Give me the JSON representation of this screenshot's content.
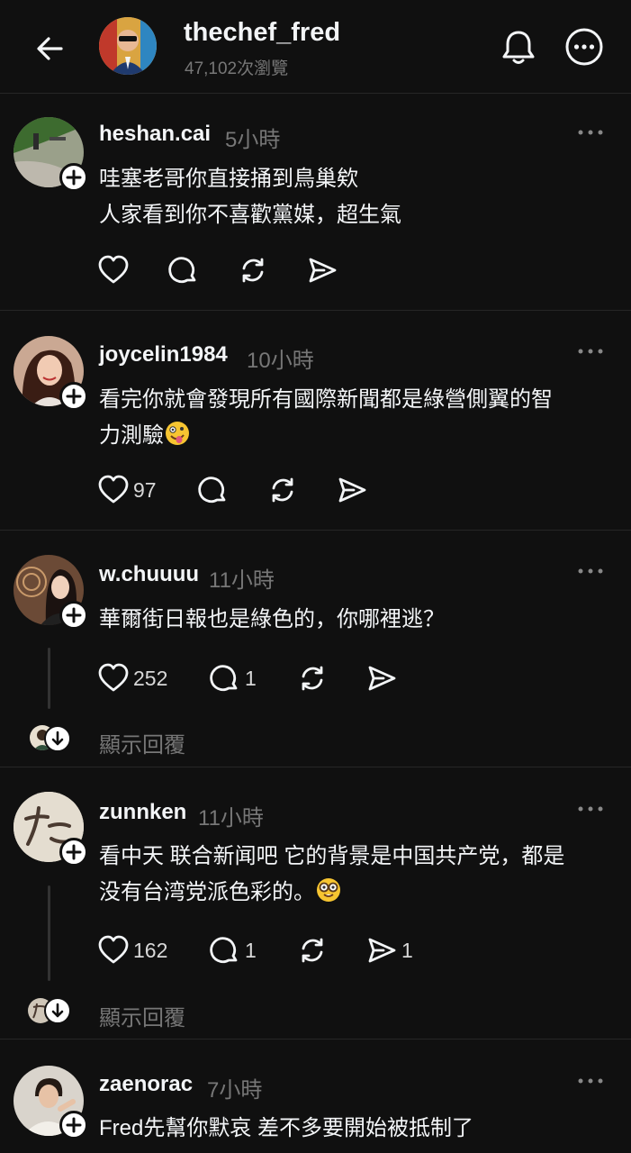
{
  "header": {
    "username": "thechef_fred",
    "views": "47,102次瀏覽"
  },
  "posts": [
    {
      "username": "heshan.cai",
      "time": "5小時",
      "lines": [
        "哇塞老哥你直接捅到鳥巢欸",
        "人家看到你不喜歡黨媒，超生氣"
      ],
      "likes": "",
      "replies": "",
      "shares": ""
    },
    {
      "username": "joycelin1984",
      "time": "10小時",
      "lines": [
        "看完你就會發現所有國際新聞都是綠營側翼的智",
        "力測驗"
      ],
      "likes": "97",
      "replies": "",
      "shares": ""
    },
    {
      "username": "w.chuuuu",
      "time": "11小時",
      "lines": [
        "華爾街日報也是綠色的，你哪裡逃？"
      ],
      "likes": "252",
      "replies": "1",
      "shares": "",
      "show_replies": "顯示回覆"
    },
    {
      "username": "zunnken",
      "time": "11小時",
      "lines": [
        "看中天 联合新闻吧 它的背景是中国共产党，都是",
        "没有台湾党派色彩的。"
      ],
      "likes": "162",
      "replies": "1",
      "shares": "1",
      "show_replies": "顯示回覆"
    },
    {
      "username": "zaenorac",
      "time": "7小時",
      "lines": [
        "Fred先幫你默哀 差不多要開始被抵制了"
      ]
    }
  ]
}
